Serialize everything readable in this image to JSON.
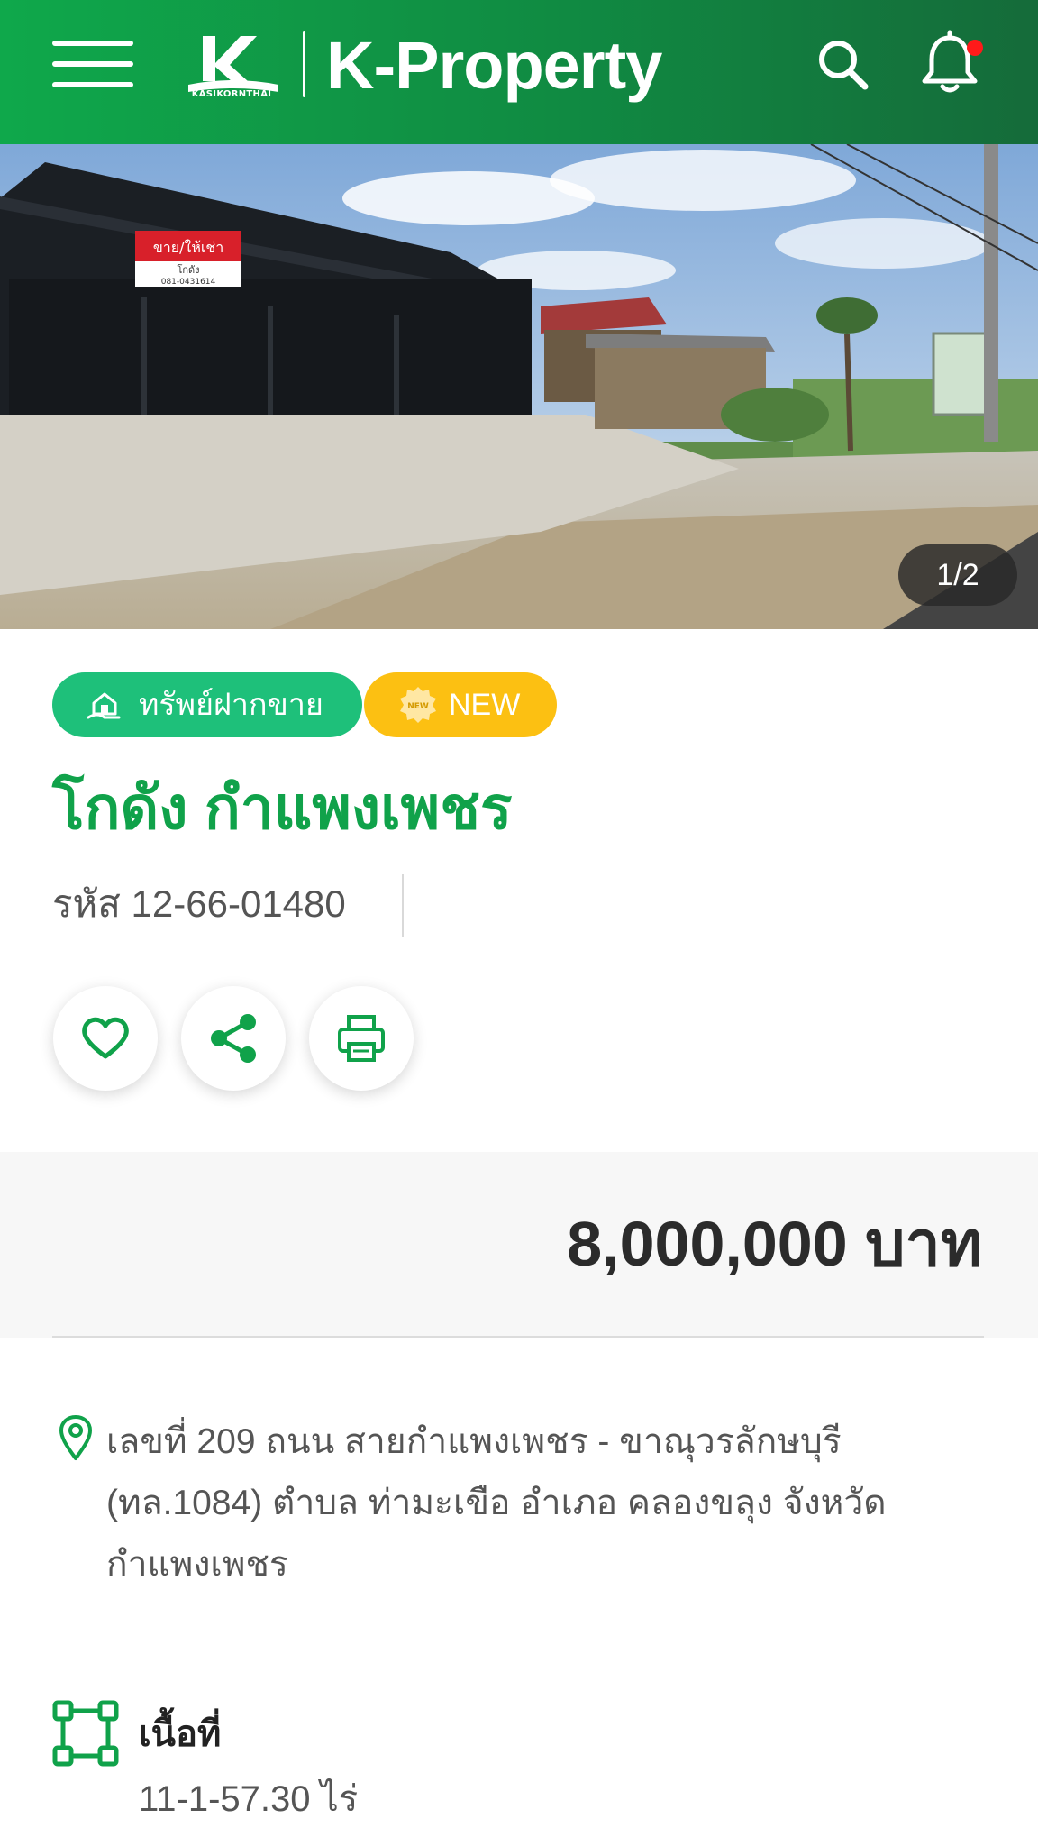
{
  "header": {
    "logo_caption": "KASIKORNTHAI",
    "brand_name": "K-Property",
    "icons": [
      "menu-icon",
      "search-icon",
      "bell-icon"
    ],
    "notification_dot_color": "#ff1a1a",
    "background_colors": [
      "#0fa84b",
      "#156b3a"
    ]
  },
  "gallery": {
    "counter": "1/2",
    "sign_text": "ขาย/ให้เช่า",
    "sign_subtext": "โกดัง",
    "sign_phone": "081-0431614"
  },
  "listing": {
    "badges": [
      {
        "label": "ทรัพย์ฝากขาย",
        "icon": "hand-house-icon",
        "color": "#1ec07a"
      },
      {
        "label": "NEW",
        "icon": "new-seal-icon",
        "color": "#fcc012",
        "icon_text": "NEW"
      }
    ],
    "title": "โกดัง กำแพงเพชร",
    "code": "รหัส 12-66-01480",
    "actions": [
      "favorite-icon",
      "share-icon",
      "print-icon"
    ],
    "price": "8,000,000 บาท",
    "address": "เลขที่ 209 ถนน สายกำแพงเพชร - ขาณุวรลักษบุรี (ทล.1084) ตำบล ท่ามะเขือ อำเภอ คลองขลุง จังหวัด กำแพงเพชร",
    "area_label": "เนื้อที่",
    "area_value": "11-1-57.30 ไร่",
    "accent_color": "#10a24a"
  }
}
